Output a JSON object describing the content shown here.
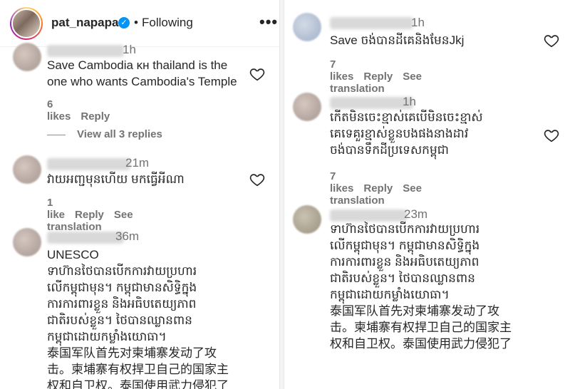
{
  "header": {
    "username": "pat_napapa",
    "verified_mark": "✓",
    "separator": "•",
    "follow_label": "Following",
    "more_label": "•••"
  },
  "left": {
    "comments": [
      {
        "text": "Save Cambodia ĸн thailand is the one who wants Cambodia's Temple",
        "likes": "6 likes",
        "reply": "Reply",
        "time": "1h"
      },
      {
        "view_replies": "View all 3 replies"
      },
      {
        "time": "21m",
        "text": "វាយអញ្ជមុនហើយ មកធ្វើអីណា",
        "likes": "1 like",
        "reply": "Reply",
        "translate": "See translation"
      },
      {
        "time": "36m",
        "text": "UNESCO\nទាហ៊ានថៃបានបើកការវាយប្រហារ\nលើកម្ពុជាមុន។ កម្ពុជាមានសិទ្ធិក្នុង\nការការពារខ្លួន និងអធិបតេយ្យភាព\nជាតិរបស់ខ្លួន។ ថៃបានឈ្លានពាន\nកម្ពុជាដោយកម្លាំងយោធា។\n泰国军队首先对柬埔寨发动了攻\n击。柬埔寨有权捍卫自己的国家主\n权和自卫权。泰国使用武力侵犯了"
      }
    ]
  },
  "right": {
    "comments": [
      {
        "time": "1h",
        "text": "Save ចង់បានដីគេនិងមែនJkj",
        "likes": "7 likes",
        "reply": "Reply",
        "translate": "See translation"
      },
      {
        "time": "1h",
        "text": "កើតមិនចេះខ្មាស់គេបើមិនចេះខ្មាស់\nគេទេគួរខ្មាស់ខ្លួនបងផងនាងដាវ\nចង់បានទឹកដីប្រទេសកម្ពុជា",
        "likes": "7 likes",
        "reply": "Reply",
        "translate": "See translation"
      },
      {
        "time": "23m",
        "text": "ទាហ៊ានថៃបានបើកការវាយប្រហារ\nលើកម្ពុជាមុន។ កម្ពុជាមានសិទ្ធិក្នុង\nការការពារខ្លួន និងអធិបតេយ្យភាព\nជាតិរបស់ខ្លួន។ ថៃបានឈ្លានពាន\nកម្ពុជាដោយកម្លាំងយោធា។\n泰国军队首先对柬埔寨发动了攻\n击。柬埔寨有权捍卫自己的国家主\n权和自卫权。泰国使用武力侵犯了"
      }
    ]
  },
  "icons": {
    "heart": "heart-icon",
    "more": "more-options-icon",
    "verified": "verified-badge-icon"
  },
  "colors": {
    "verified_blue": "#0095f6",
    "muted": "#737373",
    "text": "#262626"
  }
}
